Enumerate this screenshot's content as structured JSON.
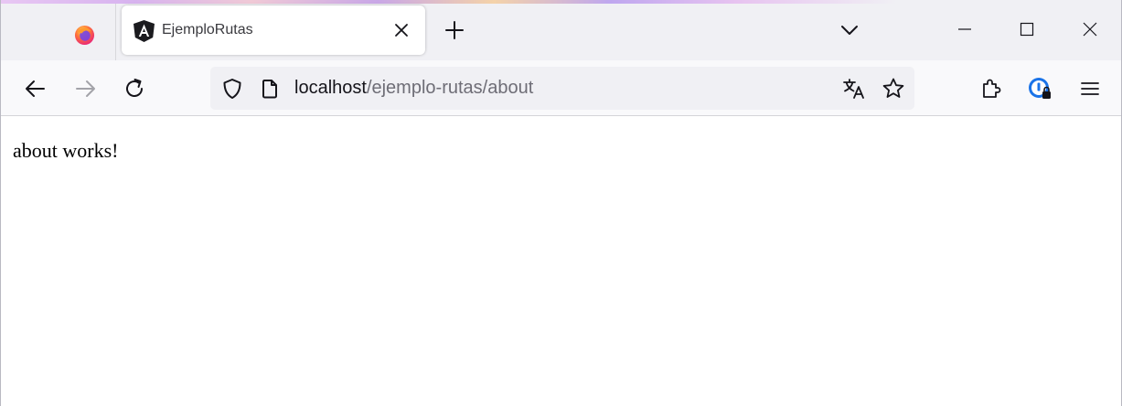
{
  "browser": {
    "tab": {
      "title": "EjemploRutas",
      "favicon": "angular-icon"
    },
    "url": {
      "host": "localhost",
      "path": "/ejemplo-rutas/about"
    },
    "icons": {
      "firefox": "firefox-icon",
      "close_tab": "close-icon",
      "new_tab": "plus-icon",
      "tab_list": "chevron-down-icon",
      "back": "arrow-left-icon",
      "forward": "arrow-right-icon",
      "reload": "reload-icon",
      "shield": "shield-icon",
      "page": "page-icon",
      "translate": "translate-icon",
      "bookmark": "star-icon",
      "extensions": "puzzle-icon",
      "password_manager": "password-manager-icon",
      "menu": "hamburger-menu-icon"
    },
    "colors": {
      "tabbar_bg": "#f0f0f4",
      "navbar_bg": "#f9f9fb",
      "urlbar_bg": "#f0f0f4",
      "password_manager_accent": "#1a73e8"
    }
  },
  "page": {
    "body_text": "about works!"
  }
}
